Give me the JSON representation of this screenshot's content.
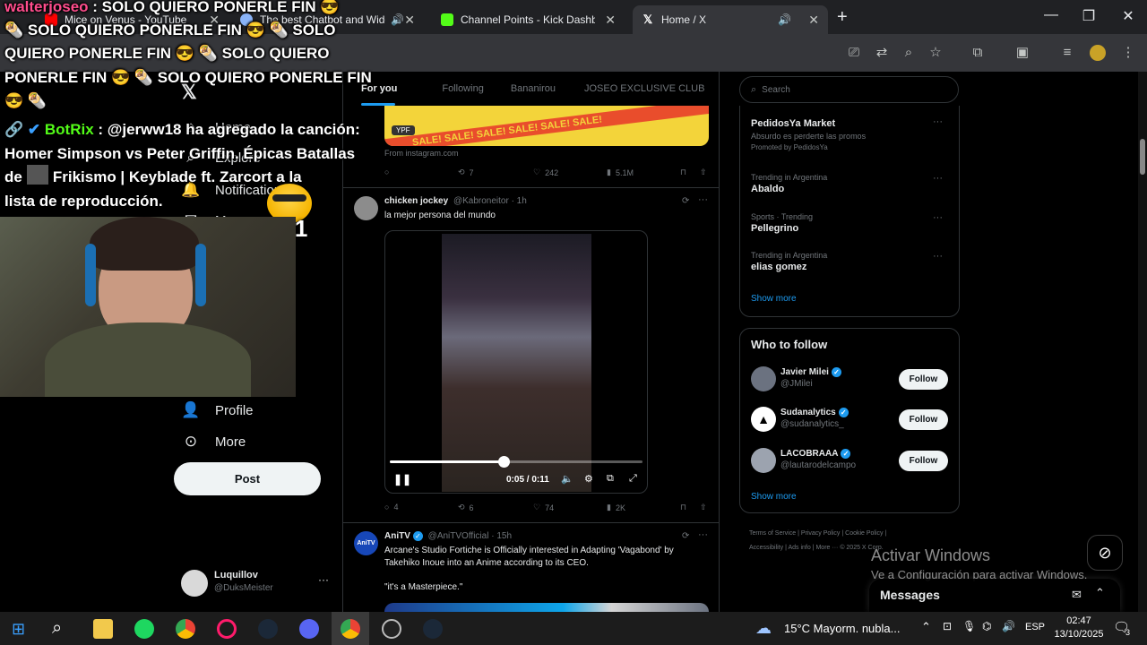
{
  "browser": {
    "tabs": [
      {
        "title": "Mice on Venus - YouTube",
        "favicon": "youtube-icon",
        "color": "#ff0000"
      },
      {
        "title": "The best Chatbot and Widg",
        "favicon": "bot-icon",
        "color": "#8ab4f8"
      },
      {
        "title": "Channel Points - Kick Dashboar",
        "favicon": "kick-icon",
        "color": "#53fc18"
      },
      {
        "title": "Home / X",
        "favicon": "x-icon",
        "color": "#ffffff"
      }
    ],
    "new_tab": "+"
  },
  "overlay": {
    "chat_lines": [
      "walterjoseo : SOLO QUIERO PONERLE FIN 😎",
      "🌯 SOLO QUIERO PONERLE FIN 😎 🌯 SOLO",
      "QUIERO PONERLE FIN 😎 🌯 SOLO QUIERO",
      "PONERLE FIN 😎 🌯 SOLO QUIERO PONERLE FIN",
      "😎 🌯",
      "🔗 ✔ BotRix : @jerww18 ha agregado la canción:",
      "Homer Simpson vs Peter Griffin. Épicas Batallas",
      "de      del Frikismo | Keyblade ft. Zarcort a la",
      "lista de reproducción."
    ],
    "multiplier": "x51"
  },
  "sidebar": {
    "items": [
      {
        "label": "Home",
        "icon": "home-icon"
      },
      {
        "label": "Explore",
        "icon": "search-icon"
      },
      {
        "label": "Notifications",
        "icon": "bell-icon"
      },
      {
        "label": "Messages",
        "icon": "mail-icon"
      },
      {
        "label": "Profile",
        "icon": "person-icon"
      },
      {
        "label": "More",
        "icon": "more-circle-icon"
      }
    ],
    "post_label": "Post",
    "account": {
      "name": "Luquillov",
      "handle": "@DuksMeister"
    }
  },
  "timeline": {
    "tabs": [
      "For you",
      "Following",
      "Bananirou",
      "JOSEO EXCLUSIVE CLUB"
    ],
    "tweet1": {
      "ad_tag": "YPF",
      "banner_text": "SALE!  SALE!  SALE!  SALE!  SALE!  SALE!",
      "source": "From instagram.com",
      "retweets": "7",
      "likes": "242",
      "views": "5.1M"
    },
    "tweet2": {
      "name": "chicken jockey",
      "handle": "@Kabroneitor · 1h",
      "text": "la mejor persona del mundo",
      "video_time": "0:05 / 0:11",
      "video_progress": 0.45,
      "replies": "4",
      "retweets": "6",
      "likes": "74",
      "views": "2K"
    },
    "tweet3": {
      "name": "AniTV",
      "handle": "@AniTVOfficial · 15h",
      "text": "Arcane's Studio Fortiche is Officially interested in Adapting 'Vagabond' by Takehiko Inoue into an Anime according to its CEO.",
      "quote": "\"it's a Masterpiece.\""
    }
  },
  "right": {
    "search_placeholder": "Search",
    "trends": [
      {
        "meta": "",
        "name": "PedidosYa Market",
        "desc": "Absurdo es perderte las promos",
        "promo": "Promoted by PedidosYa"
      },
      {
        "meta": "Trending in Argentina",
        "name": "Abaldo"
      },
      {
        "meta": "Sports · Trending",
        "name": "Pellegrino"
      },
      {
        "meta": "Trending in Argentina",
        "name": "elias gomez"
      }
    ],
    "show_more": "Show more",
    "who_to_follow": "Who to follow",
    "follow_list": [
      {
        "name": "Javier Milei",
        "handle": "@JMilei",
        "button": "Follow"
      },
      {
        "name": "Sudanalytics",
        "handle": "@sudanalytics_",
        "button": "Follow"
      },
      {
        "name": "LACOBRAAA",
        "handle": "@lautarodelcampo",
        "button": "Follow"
      }
    ],
    "show_more_2": "Show more",
    "footer": [
      "Terms of Service",
      "Privacy Policy",
      "Cookie Policy",
      "Accessibility",
      "Ads info",
      "More ···",
      "© 2025 X Corp."
    ]
  },
  "activate": {
    "title": "Activar Windows",
    "subtitle": "Ve a Configuración para activar Windows."
  },
  "messages_bar": {
    "label": "Messages"
  },
  "taskbar": {
    "weather": "15°C  Mayorm. nubla...",
    "lang": "ESP",
    "time": "02:47",
    "date": "13/10/2025",
    "notif_count": "3"
  }
}
